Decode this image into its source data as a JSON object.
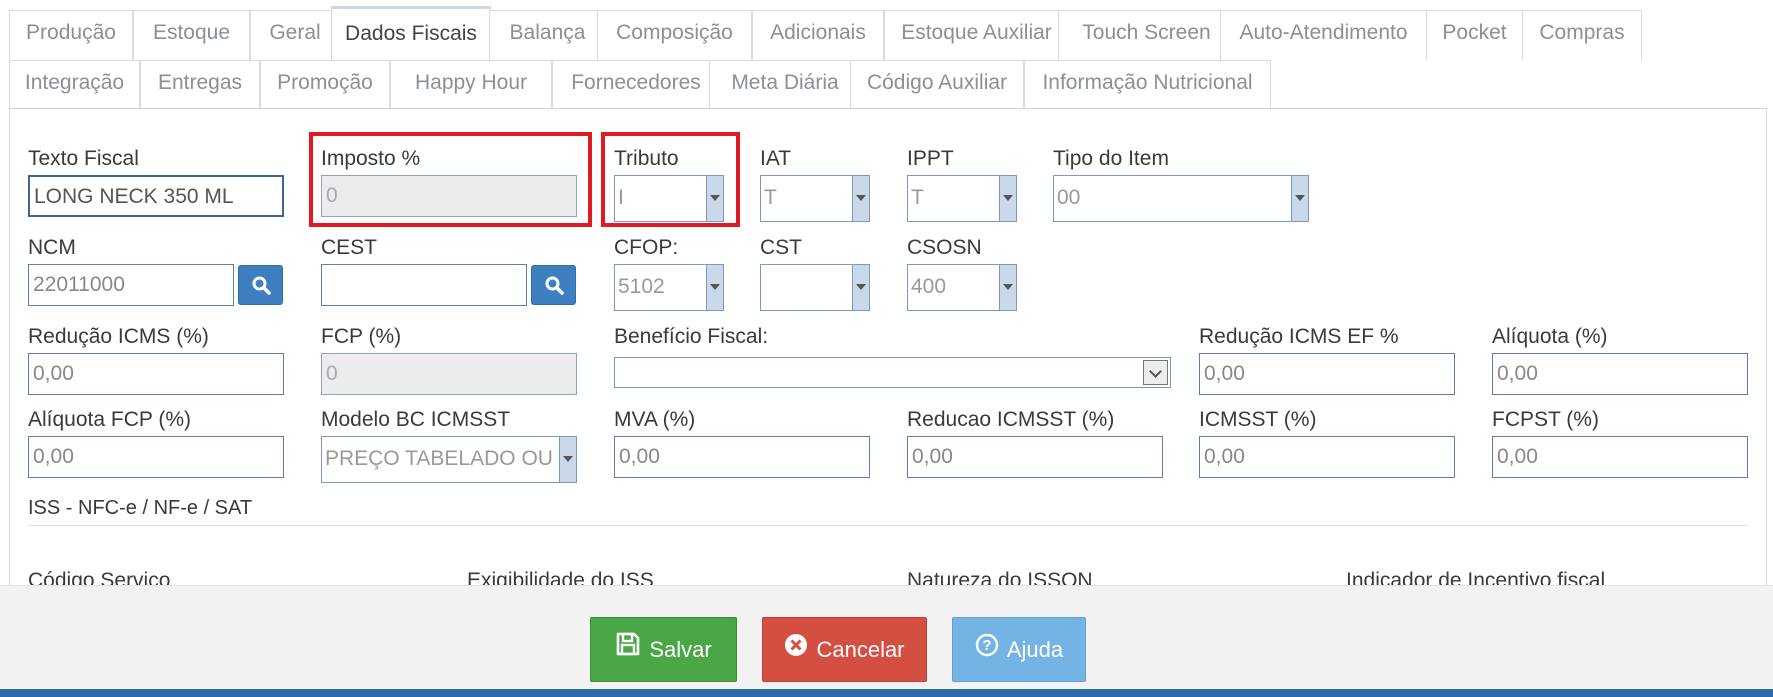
{
  "tabs": {
    "row1": [
      "Produção",
      "Estoque",
      "Geral",
      "Dados Fiscais",
      "Balança",
      "Composição",
      "Adicionais",
      "Estoque Auxiliar",
      "Touch Screen",
      "Auto-Atendimento",
      "Pocket",
      "Compras"
    ],
    "row2": [
      "Integração",
      "Entregas",
      "Promoção",
      "Happy Hour",
      "Fornecedores",
      "Meta Diária",
      "Código Auxiliar",
      "Informação Nutricional"
    ],
    "active": "Dados Fiscais"
  },
  "form": {
    "texto_fiscal": {
      "label": "Texto Fiscal",
      "value": "LONG NECK 350 ML"
    },
    "imposto": {
      "label": "Imposto %",
      "value": "0"
    },
    "tributo": {
      "label": "Tributo",
      "value": "I"
    },
    "iat": {
      "label": "IAT",
      "value": "T"
    },
    "ippt": {
      "label": "IPPT",
      "value": "T"
    },
    "tipo_item": {
      "label": "Tipo do Item",
      "value": "00"
    },
    "ncm": {
      "label": "NCM",
      "value": "22011000"
    },
    "cest": {
      "label": "CEST",
      "value": ""
    },
    "cfop": {
      "label": "CFOP:",
      "value": "5102"
    },
    "cst": {
      "label": "CST",
      "value": ""
    },
    "csosn": {
      "label": "CSOSN",
      "value": "400"
    },
    "reducao_icms": {
      "label": "Redução ICMS (%)",
      "value": "0,00"
    },
    "fcp": {
      "label": "FCP (%)",
      "value": "0"
    },
    "beneficio_fiscal": {
      "label": "Benefício Fiscal:",
      "value": ""
    },
    "reducao_icms_ef": {
      "label": "Redução ICMS EF %",
      "value": "0,00"
    },
    "aliquota": {
      "label": "Alíquota (%)",
      "value": "0,00"
    },
    "aliquota_fcp": {
      "label": "Alíquota FCP (%)",
      "value": "0,00"
    },
    "modelo_bc_icmsst": {
      "label": "Modelo BC ICMSST",
      "value": "PREÇO TABELADO OU M"
    },
    "mva": {
      "label": "MVA (%)",
      "value": "0,00"
    },
    "reducao_icmsst": {
      "label": "Reducao ICMSST (%)",
      "value": "0,00"
    },
    "icmsst": {
      "label": "ICMSST (%)",
      "value": "0,00"
    },
    "fcpst": {
      "label": "FCPST (%)",
      "value": "0,00"
    }
  },
  "iss_section": {
    "title": "ISS - NFC-e / NF-e / SAT",
    "labels": [
      "Código Servico",
      "Exigibilidade do ISS",
      "Natureza do ISSQN",
      "Indicador de Incentivo fiscal"
    ]
  },
  "footer": {
    "save": "Salvar",
    "cancel": "Cancelar",
    "help": "Ajuda"
  },
  "colors": {
    "highlight": "#e01b24",
    "save": "#4aa746",
    "cancel": "#d54e42",
    "help": "#73b4e4"
  }
}
